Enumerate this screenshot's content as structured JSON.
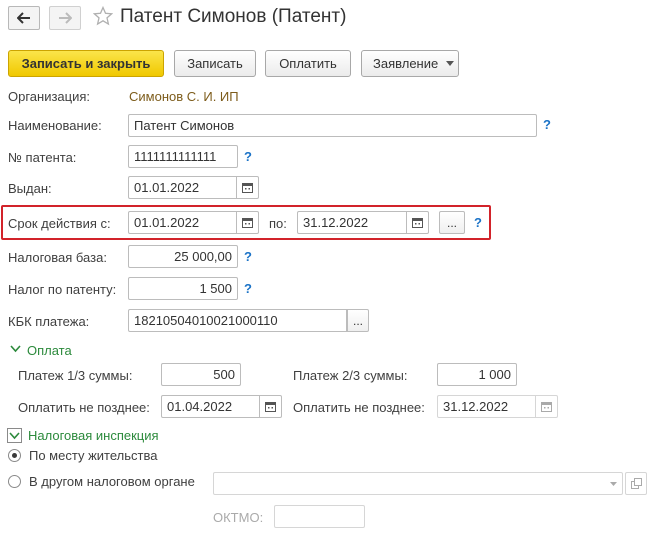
{
  "window": {
    "title": "Патент Симонов (Патент)"
  },
  "toolbar": {
    "save_close": "Записать и закрыть",
    "save": "Записать",
    "pay": "Оплатить",
    "statement": "Заявление"
  },
  "form": {
    "organization_label": "Организация:",
    "organization_value": "Симонов С. И. ИП",
    "name_label": "Наименование:",
    "name_value": "Патент Симонов",
    "patent_no_label": "№ патента:",
    "patent_no_value": "1111111111111",
    "issued_label": "Выдан:",
    "issued_value": "01.01.2022",
    "valid_from_label": "Срок действия с:",
    "valid_from_value": "01.01.2022",
    "valid_to_label": "по:",
    "valid_to_value": "31.12.2022",
    "tax_base_label": "Налоговая база:",
    "tax_base_value": "25 000,00",
    "patent_tax_label": "Налог по патенту:",
    "patent_tax_value": "1 500",
    "kbk_label": "КБК платежа:",
    "kbk_value": "18210504010021000110",
    "help": "?",
    "dots": "..."
  },
  "payment": {
    "section_title": "Оплата",
    "pay1_label": "Платеж 1/3 суммы:",
    "pay1_value": "500",
    "pay2_label": "Платеж 2/3 суммы:",
    "pay2_value": "1 000",
    "due1_label": "Оплатить не позднее:",
    "due1_value": "01.04.2022",
    "due2_label": "Оплатить не позднее:",
    "due2_value": "31.12.2022"
  },
  "tax_office": {
    "section_title": "Налоговая инспекция",
    "option_residence": "По месту жительства",
    "option_other": "В другом налоговом органе",
    "other_value": "",
    "oktmo_label": "ОКТМО:",
    "oktmo_value": ""
  },
  "colors": {
    "accent_yellow": "#f5d21c",
    "highlight_red": "#d2232a",
    "link_blue": "#1b73c7",
    "section_green": "#2c8a3c",
    "value_brown": "#7d5c1b"
  }
}
